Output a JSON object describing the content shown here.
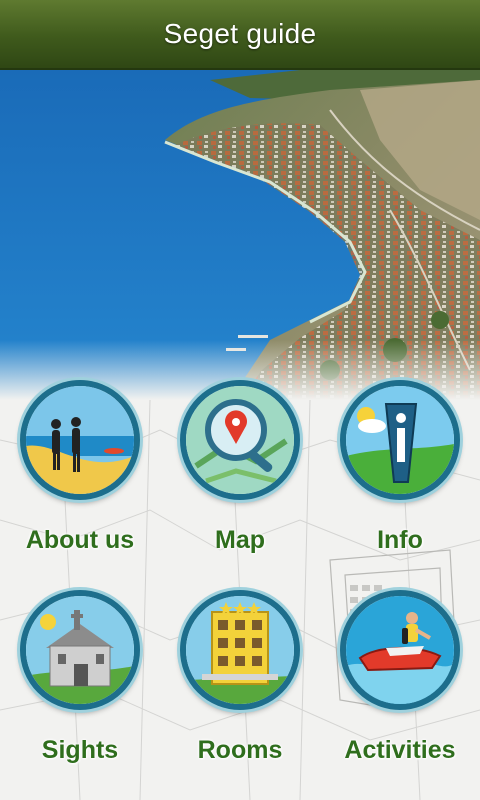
{
  "header": {
    "title": "Seget guide"
  },
  "colors": {
    "header_green": "#3f5a1c",
    "label_green": "#2f6e1d",
    "ring_blue": "#1d6e8c",
    "sea_blue": "#1f78c4"
  },
  "menu": [
    {
      "label": "About us",
      "icon": "couple-beach-icon"
    },
    {
      "label": "Map",
      "icon": "map-magnifier-icon"
    },
    {
      "label": "Info",
      "icon": "info-icon"
    },
    {
      "label": "Sights",
      "icon": "church-icon"
    },
    {
      "label": "Rooms",
      "icon": "hotel-icon"
    },
    {
      "label": "Activities",
      "icon": "jet-ski-icon"
    }
  ]
}
